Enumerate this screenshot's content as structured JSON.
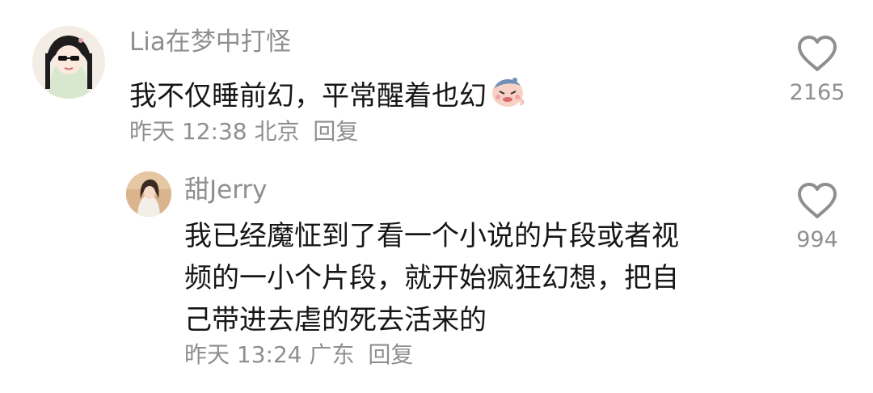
{
  "comments": [
    {
      "username": "Lia在梦中打怪",
      "text": "我不仅睡前幻，平常醒着也幻",
      "emoji": "crying-face-emoji",
      "time": "昨天 12:38",
      "location": "北京",
      "reply_label": "回复",
      "likes": "2165"
    },
    {
      "username": "甜Jerry",
      "text_lines": [
        "我已经魔怔到了看一个小说的片段或者视",
        "频的一小个片段，就开始疯狂幻想，把自",
        "己带进去虐的死去活来的"
      ],
      "time": "昨天 13:24",
      "location": "广东",
      "reply_label": "回复",
      "likes": "994"
    }
  ],
  "icons": {
    "like": "heart-outline-icon"
  },
  "colors": {
    "muted": "#8f8f8f",
    "text": "#161616",
    "background": "#ffffff"
  }
}
